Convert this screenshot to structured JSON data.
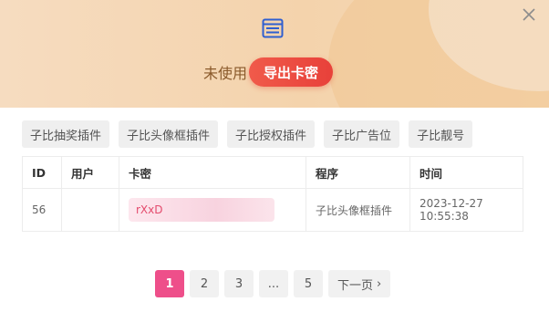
{
  "header": {
    "status_label": "未使用",
    "export_button_label": "导出卡密"
  },
  "tabs": [
    {
      "label": "子比抽奖插件"
    },
    {
      "label": "子比头像框插件"
    },
    {
      "label": "子比授权插件"
    },
    {
      "label": "子比广告位"
    },
    {
      "label": "子比靓号"
    }
  ],
  "table": {
    "columns": [
      "ID",
      "用户",
      "卡密",
      "程序",
      "时间"
    ],
    "rows": [
      {
        "id": "56",
        "user": "",
        "code": "rXxD",
        "program": "子比头像框插件",
        "time": "2023-12-27 10:55:38"
      }
    ]
  },
  "pagination": {
    "pages": [
      "1",
      "2",
      "3",
      "...",
      "5"
    ],
    "current": "1",
    "next_label": "下一页"
  },
  "colors": {
    "accent": "#ee4f8a",
    "export_button": "#e8413a",
    "header_bg": "#f4d3ac"
  },
  "icons": {
    "header": "card-list-icon",
    "close": "close-icon",
    "next": "chevron-right-icon"
  }
}
